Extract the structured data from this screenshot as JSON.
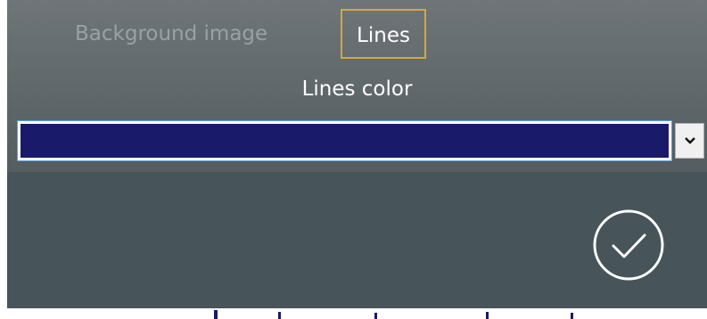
{
  "tabs": [
    {
      "label": "Background image",
      "active": false
    },
    {
      "label": "Lines",
      "active": true
    }
  ],
  "section": {
    "label": "Lines color"
  },
  "color_select": {
    "selected_color": "#1a1a6a",
    "arrow_icon": "chevron-down-icon"
  },
  "actions": {
    "confirm_icon": "check-circle-icon"
  },
  "colors": {
    "panel_upper": "#6f7578",
    "panel_lower": "#47545a",
    "tab_active_border": "#d4a83a",
    "tab_inactive_text": "#9aa1a5",
    "text": "#ffffff"
  }
}
